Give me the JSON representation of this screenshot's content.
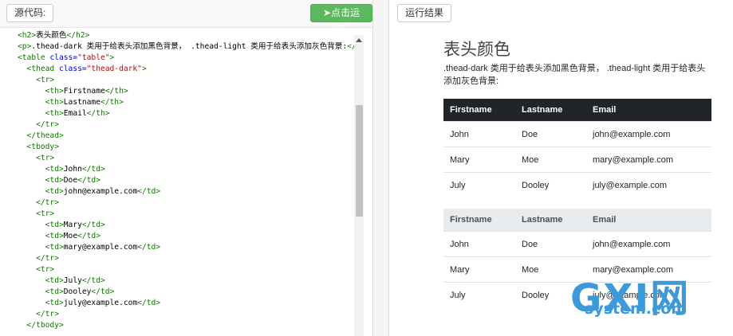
{
  "toolbar": {
    "source_label": "源代码:",
    "run_label": "点击运行",
    "result_label": "运行结果"
  },
  "code": [
    {
      "parts": [
        {
          "t": "<h2>",
          "c": "tag"
        },
        {
          "t": "表头颜色",
          "c": ""
        },
        {
          "t": "</h2>",
          "c": "tag"
        }
      ]
    },
    {
      "parts": [
        {
          "t": "<p>",
          "c": "tag"
        },
        {
          "t": ".thead-dark 类用于给表头添加黑色背景， .thead-light 类用于给表头添加灰色背景:",
          "c": ""
        },
        {
          "t": "</",
          "c": "tag"
        }
      ]
    },
    {
      "parts": [
        {
          "t": "<table ",
          "c": "tag"
        },
        {
          "t": "class=",
          "c": "attr"
        },
        {
          "t": "\"table\"",
          "c": "str"
        },
        {
          "t": ">",
          "c": "tag"
        }
      ]
    },
    {
      "parts": [
        {
          "t": "  <thead ",
          "c": "tag"
        },
        {
          "t": "class=",
          "c": "attr"
        },
        {
          "t": "\"thead-dark\"",
          "c": "str"
        },
        {
          "t": ">",
          "c": "tag"
        }
      ]
    },
    {
      "parts": [
        {
          "t": "    <tr>",
          "c": "tag"
        }
      ]
    },
    {
      "parts": [
        {
          "t": "      <th>",
          "c": "tag"
        },
        {
          "t": "Firstname",
          "c": ""
        },
        {
          "t": "</th>",
          "c": "tag"
        }
      ]
    },
    {
      "parts": [
        {
          "t": "      <th>",
          "c": "tag"
        },
        {
          "t": "Lastname",
          "c": ""
        },
        {
          "t": "</th>",
          "c": "tag"
        }
      ]
    },
    {
      "parts": [
        {
          "t": "      <th>",
          "c": "tag"
        },
        {
          "t": "Email",
          "c": ""
        },
        {
          "t": "</th>",
          "c": "tag"
        }
      ]
    },
    {
      "parts": [
        {
          "t": "    </tr>",
          "c": "tag"
        }
      ]
    },
    {
      "parts": [
        {
          "t": "  </thead>",
          "c": "tag"
        }
      ]
    },
    {
      "parts": [
        {
          "t": "  <tbody>",
          "c": "tag"
        }
      ]
    },
    {
      "parts": [
        {
          "t": "    <tr>",
          "c": "tag"
        }
      ]
    },
    {
      "parts": [
        {
          "t": "      <td>",
          "c": "tag"
        },
        {
          "t": "John",
          "c": ""
        },
        {
          "t": "</td>",
          "c": "tag"
        }
      ]
    },
    {
      "parts": [
        {
          "t": "      <td>",
          "c": "tag"
        },
        {
          "t": "Doe",
          "c": ""
        },
        {
          "t": "</td>",
          "c": "tag"
        }
      ]
    },
    {
      "parts": [
        {
          "t": "      <td>",
          "c": "tag"
        },
        {
          "t": "john@example.com",
          "c": ""
        },
        {
          "t": "</td>",
          "c": "tag"
        }
      ]
    },
    {
      "parts": [
        {
          "t": "    </tr>",
          "c": "tag"
        }
      ]
    },
    {
      "parts": [
        {
          "t": "    <tr>",
          "c": "tag"
        }
      ]
    },
    {
      "parts": [
        {
          "t": "      <td>",
          "c": "tag"
        },
        {
          "t": "Mary",
          "c": ""
        },
        {
          "t": "</td>",
          "c": "tag"
        }
      ]
    },
    {
      "parts": [
        {
          "t": "      <td>",
          "c": "tag"
        },
        {
          "t": "Moe",
          "c": ""
        },
        {
          "t": "</td>",
          "c": "tag"
        }
      ]
    },
    {
      "parts": [
        {
          "t": "      <td>",
          "c": "tag"
        },
        {
          "t": "mary@example.com",
          "c": ""
        },
        {
          "t": "</td>",
          "c": "tag"
        }
      ]
    },
    {
      "parts": [
        {
          "t": "    </tr>",
          "c": "tag"
        }
      ]
    },
    {
      "parts": [
        {
          "t": "    <tr>",
          "c": "tag"
        }
      ]
    },
    {
      "parts": [
        {
          "t": "      <td>",
          "c": "tag"
        },
        {
          "t": "July",
          "c": ""
        },
        {
          "t": "</td>",
          "c": "tag"
        }
      ]
    },
    {
      "parts": [
        {
          "t": "      <td>",
          "c": "tag"
        },
        {
          "t": "Dooley",
          "c": ""
        },
        {
          "t": "</td>",
          "c": "tag"
        }
      ]
    },
    {
      "parts": [
        {
          "t": "      <td>",
          "c": "tag"
        },
        {
          "t": "july@example.com",
          "c": ""
        },
        {
          "t": "</td>",
          "c": "tag"
        }
      ]
    },
    {
      "parts": [
        {
          "t": "    </tr>",
          "c": "tag"
        }
      ]
    },
    {
      "parts": [
        {
          "t": "  </tbody>",
          "c": "tag"
        }
      ]
    }
  ],
  "result": {
    "title": "表头颜色",
    "desc": ".thead-dark 类用于给表头添加黑色背景， .thead-light 类用于给表头添加灰色背景:",
    "headers": [
      "Firstname",
      "Lastname",
      "Email"
    ],
    "rows": [
      [
        "John",
        "Doe",
        "john@example.com"
      ],
      [
        "Mary",
        "Moe",
        "mary@example.com"
      ],
      [
        "July",
        "Dooley",
        "july@example.com"
      ]
    ],
    "rows2": [
      [
        "John",
        "Doe",
        "john@example.com"
      ],
      [
        "Mary",
        "Moe",
        "mary@example.com"
      ],
      [
        "July",
        "Dooley",
        "july@example.com"
      ]
    ]
  },
  "watermark": {
    "big": "GXI网",
    "small": "system.com"
  }
}
